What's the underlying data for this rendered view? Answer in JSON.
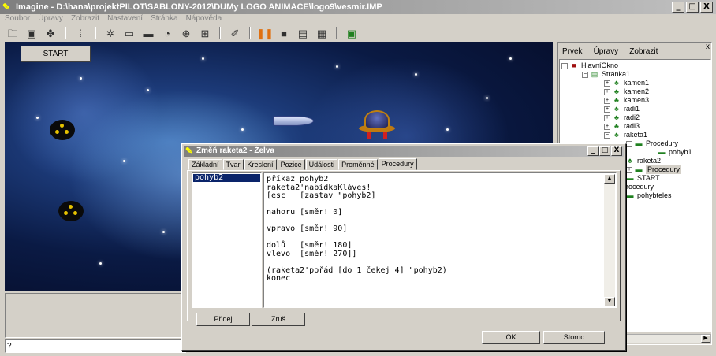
{
  "window": {
    "title": "Imagine - D:\\hana\\projektPILOT\\SABLONY-2012\\DUMy LOGO ANIMACE\\logo9\\vesmir.IMP",
    "minimize": "_",
    "maximize": "□",
    "close": "X"
  },
  "menu": [
    "Soubor",
    "Úpravy",
    "Zobrazit",
    "Nastavení",
    "Stránka",
    "Nápověda"
  ],
  "canvas": {
    "start_button": "START"
  },
  "command_line": "?",
  "right_panel": {
    "menu": [
      "Prvek",
      "Úpravy",
      "Zobrazit"
    ],
    "close": "x",
    "tree": [
      {
        "label": "HlavníOkno",
        "icon": "window-icon"
      },
      {
        "label": "Stránka1",
        "icon": "page-icon"
      },
      {
        "label": "kamen1",
        "icon": "turtle-icon"
      },
      {
        "label": "kamen2",
        "icon": "turtle-icon"
      },
      {
        "label": "kamen3",
        "icon": "turtle-icon"
      },
      {
        "label": "radi1",
        "icon": "turtle-icon"
      },
      {
        "label": "radi2",
        "icon": "turtle-icon"
      },
      {
        "label": "radi3",
        "icon": "turtle-icon"
      },
      {
        "label": "raketa1",
        "icon": "turtle-icon"
      },
      {
        "label": "Procedury",
        "icon": "procedures-icon"
      },
      {
        "label": "pohyb1",
        "icon": "procedure-icon"
      },
      {
        "label": "raketa2",
        "icon": "turtle-icon"
      },
      {
        "label": "Procedury",
        "icon": "procedures-icon"
      },
      {
        "label": "START",
        "icon": "button-icon"
      },
      {
        "label": "rocedury",
        "icon": "procedures-icon"
      },
      {
        "label": "pohybteles",
        "icon": "procedure-icon"
      }
    ]
  },
  "dialog": {
    "title": "Změň raketa2 - Želva",
    "tabs": [
      "Základní",
      "Tvar",
      "Kreslení",
      "Pozice",
      "Události",
      "Proměnné",
      "Procedury"
    ],
    "active_tab": "Procedury",
    "procedures": [
      "pohyb2"
    ],
    "code": "příkaz pohyb2\nraketa2'nabídkaKláves!\n[esc   [zastav \"pohyb2]\n\nnahoru [směr! 0]\n\nvpravo [směr! 90]\n\ndolů   [směr! 180]\nvlevo  [směr! 270]]\n\n(raketa2'pořád [do 1 čekej 4] \"pohyb2)\nkonec",
    "buttons": {
      "add": "Přidej",
      "delete": "Zruš",
      "ok": "OK",
      "cancel": "Storno"
    }
  },
  "colors": {
    "selection": "#0a246a",
    "titlebar_inactive": "#808080"
  }
}
